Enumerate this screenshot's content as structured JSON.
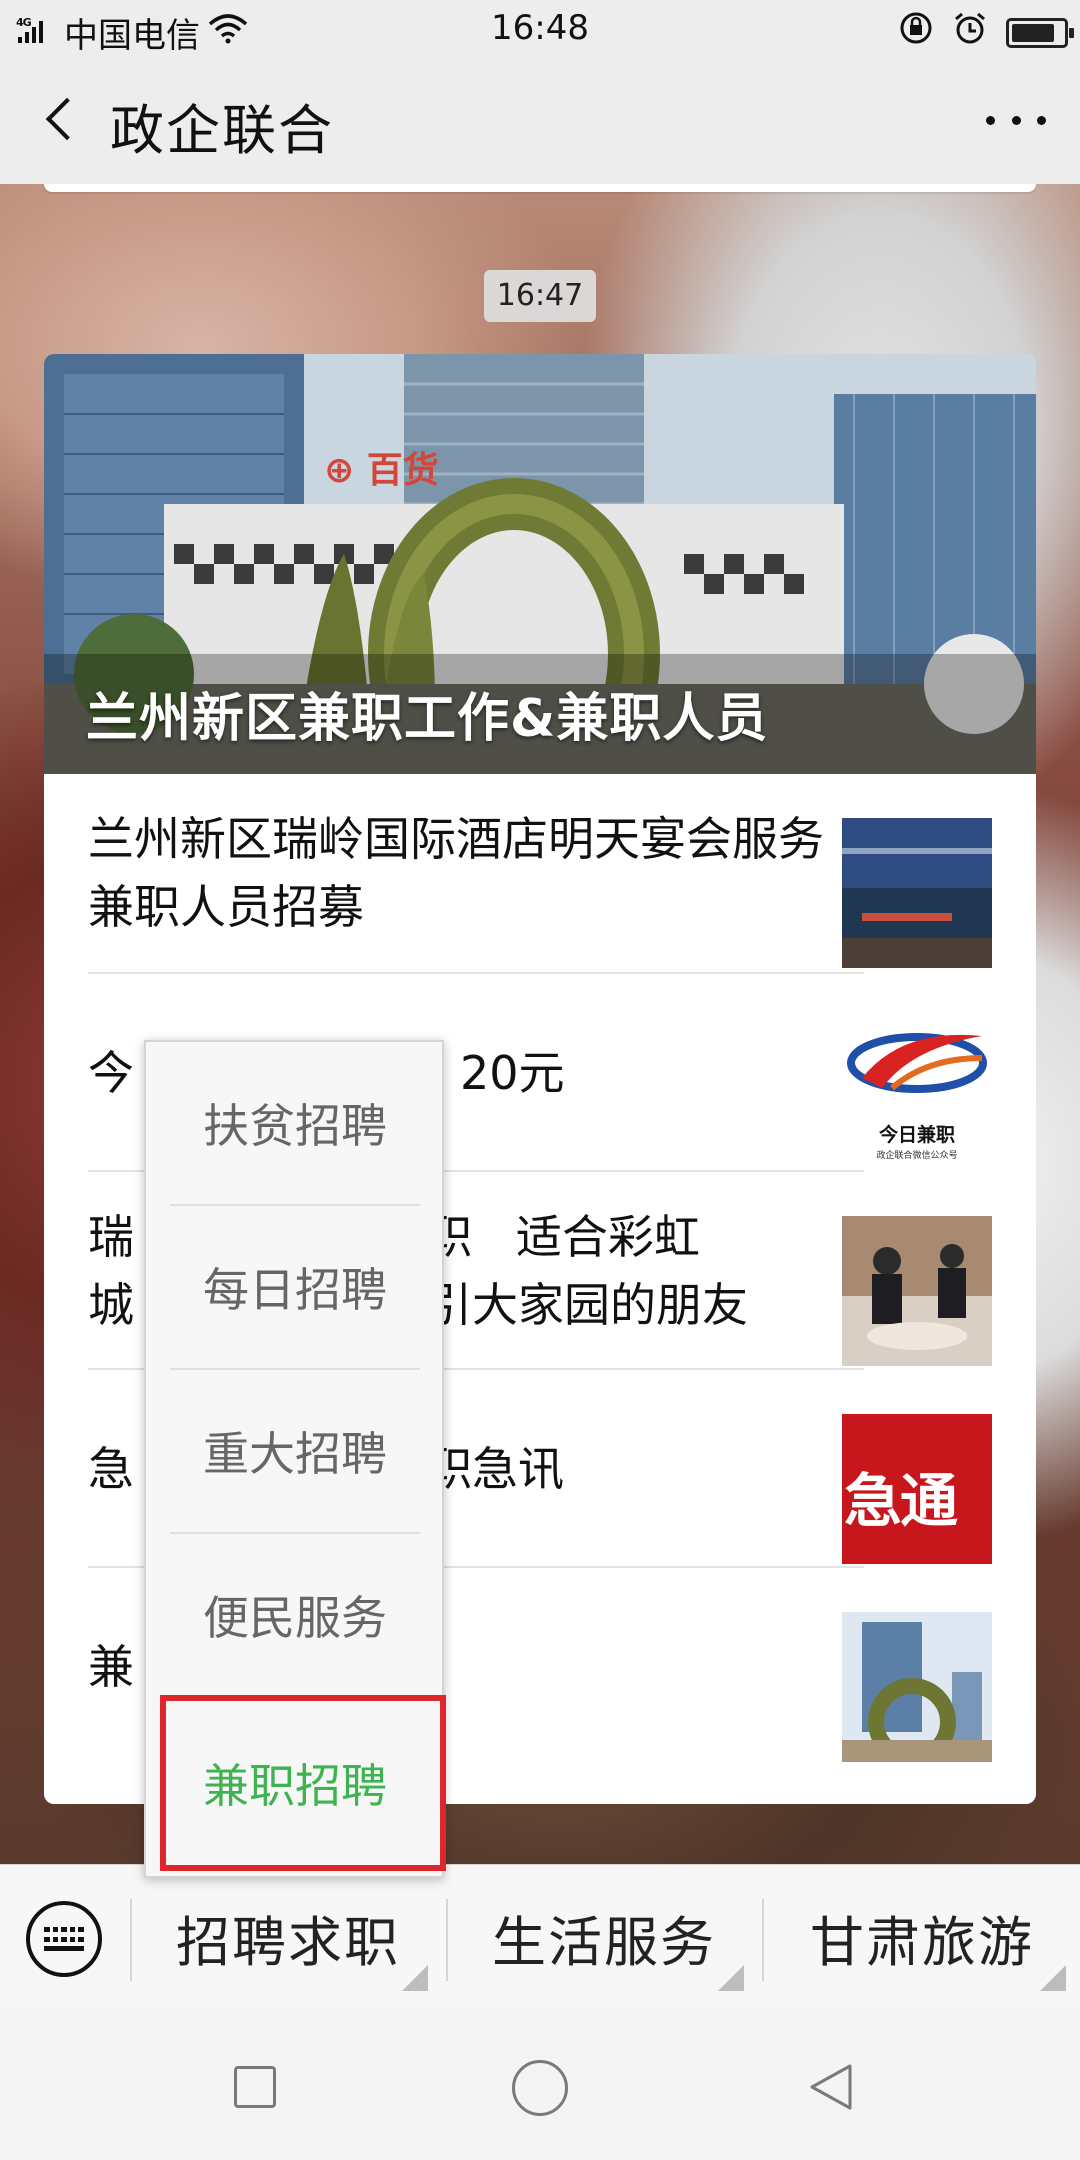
{
  "status_bar": {
    "signal_text": "4G",
    "carrier": "中国电信",
    "time": "16:48"
  },
  "header": {
    "title": "政企联合"
  },
  "chat": {
    "timestamp": "16:47",
    "cover_title": "兰州新区兼职工作&兼职人员",
    "articles": [
      {
        "title": "兰州新区瑞岭国际酒店明天宴会服务兼职人员招募",
        "thumb": "hotel-photo"
      },
      {
        "title": "今",
        "title_tail": "20元",
        "thumb": "jinri-jianzhi-logo",
        "logo_caption": "今日兼职",
        "logo_sub": "政企联合微信公众号"
      },
      {
        "title_line1_a": "瑞",
        "title_line1_b": "职   适合彩虹",
        "title_line2_a": "城",
        "title_line2_b": "引大家园的朋友",
        "thumb": "meeting-room-photo"
      },
      {
        "title": "急",
        "title_tail": "职急讯",
        "thumb": "urgent-banner",
        "thumb_text": "急通"
      },
      {
        "title": "兼",
        "thumb": "city-sculpture-photo"
      }
    ]
  },
  "submenu": {
    "items": [
      "扶贫招聘",
      "每日招聘",
      "重大招聘",
      "便民服务",
      "兼职招聘"
    ],
    "active_item": "兼职招聘"
  },
  "menu_bar": {
    "tabs": [
      "招聘求职",
      "生活服务",
      "甘肃旅游"
    ]
  }
}
